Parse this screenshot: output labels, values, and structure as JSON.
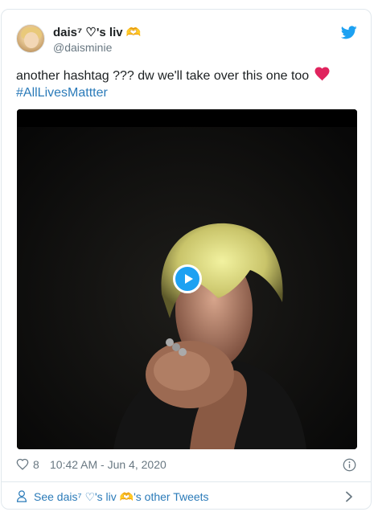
{
  "tweet": {
    "author": {
      "display_name": "dais⁷ ♡'s liv 🫶",
      "handle": "@daisminie"
    },
    "text_line1": "another hashtag ??? dw we'll take over this one too",
    "heart_emoji_icon": "red-heart-emoji-icon",
    "hashtag": "#AllLivesMattter",
    "media": {
      "type": "video",
      "play_icon": "play-icon"
    },
    "like_count": "8",
    "timestamp": "10:42 AM - Jun 4, 2020",
    "footer_link": "See dais⁷ ♡'s liv 🫶's other Tweets"
  },
  "icons": {
    "brand": "twitter-bird-icon",
    "like": "heart-outline-icon",
    "info": "info-icon",
    "profile": "user-icon",
    "chevron": "chevron-right-icon"
  },
  "colors": {
    "link": "#2b7bb9",
    "twitter_blue": "#1da1f2",
    "secondary_text": "#697882",
    "heart_red": "#e0245e"
  }
}
